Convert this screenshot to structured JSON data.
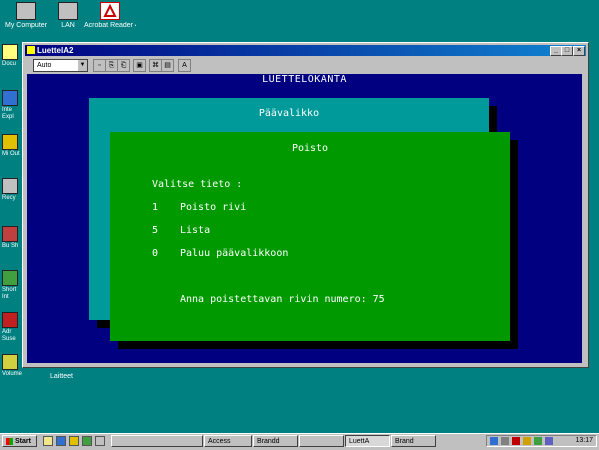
{
  "desktop": {
    "top_icons": [
      {
        "name": "my-computer",
        "label": "My Computer",
        "color": "#c0c0c0"
      },
      {
        "name": "network",
        "label": "LAN",
        "color": "#c0c0c0"
      },
      {
        "name": "acrobat",
        "label": "Acrobat Reader 4.0",
        "color": "#cc0000"
      }
    ],
    "side_icons": [
      {
        "label": "Docu",
        "color": "#ffff80"
      },
      {
        "label": "Inte Expl",
        "color": "#3070d0"
      },
      {
        "label": "Mi Out",
        "color": "#e0c000"
      },
      {
        "label": "Recy",
        "color": "#c0c0c0"
      },
      {
        "label": "Bu Sh",
        "color": "#c04040"
      },
      {
        "label": "Short Int",
        "color": "#40a040"
      },
      {
        "label": "Adr Suse",
        "color": "#c02020"
      },
      {
        "label": "Volume",
        "color": "#d0d040"
      }
    ],
    "bottom_label": "Laitteet"
  },
  "window": {
    "title": "LuettelA2",
    "font_select": "Auto",
    "controls": {
      "minimize": "_",
      "maximize": "□",
      "close": "×"
    },
    "tools": [
      "▫",
      "⎘",
      "⎗",
      "▣",
      "⌘",
      "▤",
      "A"
    ]
  },
  "dos_screen": {
    "header": "LUETTELOKANTA",
    "main_menu_title": "Päävalikko",
    "delete_panel": {
      "title": "Poisto",
      "prompt": "Valitse tieto :",
      "options": [
        {
          "key": "1",
          "label": "Poisto rivi"
        },
        {
          "key": "5",
          "label": "Lista"
        },
        {
          "key": "0",
          "label": "Paluu päävalikkoon"
        }
      ],
      "input_prompt": "Anna poistettavan rivin numero: 75"
    }
  },
  "taskbar": {
    "start_label": "Start",
    "buttons": [
      {
        "label": "",
        "pressed": false
      },
      {
        "label": "Access",
        "pressed": false
      },
      {
        "label": "Brandd",
        "pressed": false
      },
      {
        "label": "",
        "pressed": false
      },
      {
        "label": "LuettA",
        "pressed": true
      },
      {
        "label": "Brand",
        "pressed": false
      }
    ],
    "clock": "13:17"
  },
  "colors": {
    "desktop": "#008080",
    "dos_background": "#000080",
    "main_menu_panel": "#009a9a",
    "delete_panel": "#009a00"
  }
}
